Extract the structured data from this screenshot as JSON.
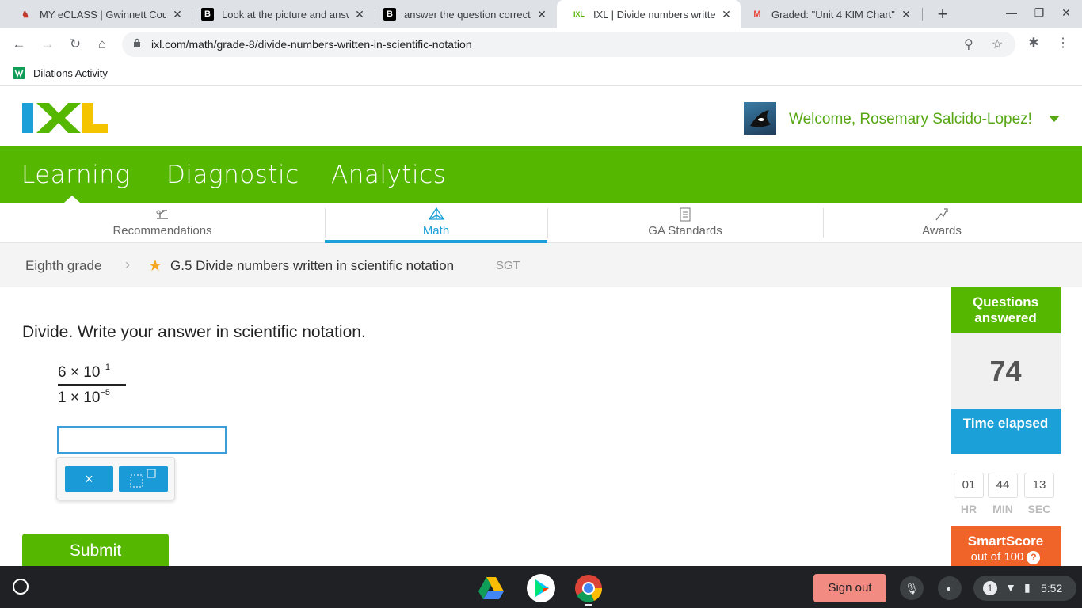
{
  "browser": {
    "tabs": [
      {
        "title": "MY eCLASS | Gwinnett County",
        "icon": "eclass-icon"
      },
      {
        "title": "Look at the picture and answer",
        "icon": "brainly-icon"
      },
      {
        "title": "answer the question correctly",
        "icon": "brainly-icon"
      },
      {
        "title": "IXL | Divide numbers written in scientific notation",
        "icon": "ixl-icon",
        "active": true
      },
      {
        "title": "Graded: \"Unit 4 KIM Chart\"",
        "icon": "gmail-icon"
      }
    ],
    "url": "ixl.com/math/grade-8/divide-numbers-written-in-scientific-notation",
    "bookmark": "Dilations Activity"
  },
  "header": {
    "welcome": "Welcome, Rosemary Salcido-Lopez!"
  },
  "mainnav": [
    "Learning",
    "Diagnostic",
    "Analytics"
  ],
  "subnav": [
    {
      "label": "Recommendations",
      "icon": "recommendations-icon"
    },
    {
      "label": "Math",
      "icon": "math-icon",
      "active": true
    },
    {
      "label": "GA Standards",
      "icon": "standards-icon"
    },
    {
      "label": "Awards",
      "icon": "awards-icon"
    }
  ],
  "breadcrumb": {
    "grade": "Eighth grade",
    "skill": "G.5 Divide numbers written in scientific notation",
    "tag": "SGT"
  },
  "problem": {
    "prompt": "Divide. Write your answer in scientific notation.",
    "numerator": {
      "coef": "6",
      "times": "×",
      "base": "10",
      "exp": "−1"
    },
    "denominator": {
      "coef": "1",
      "times": "×",
      "base": "10",
      "exp": "−5"
    },
    "answer_value": "",
    "keypad": {
      "times_label": "×"
    },
    "submit_label": "Submit"
  },
  "sidebar": {
    "questions_label": "Questions answered",
    "questions_value": "74",
    "time_label": "Time elapsed",
    "time": {
      "hr": "01",
      "min": "44",
      "sec": "13",
      "hr_label": "HR",
      "min_label": "MIN",
      "sec_label": "SEC"
    },
    "smartscore_label": "SmartScore",
    "smartscore_sub": "out of 100",
    "help": "?"
  },
  "shelf": {
    "signout": "Sign out",
    "notifications": "1",
    "clock": "5:52"
  }
}
